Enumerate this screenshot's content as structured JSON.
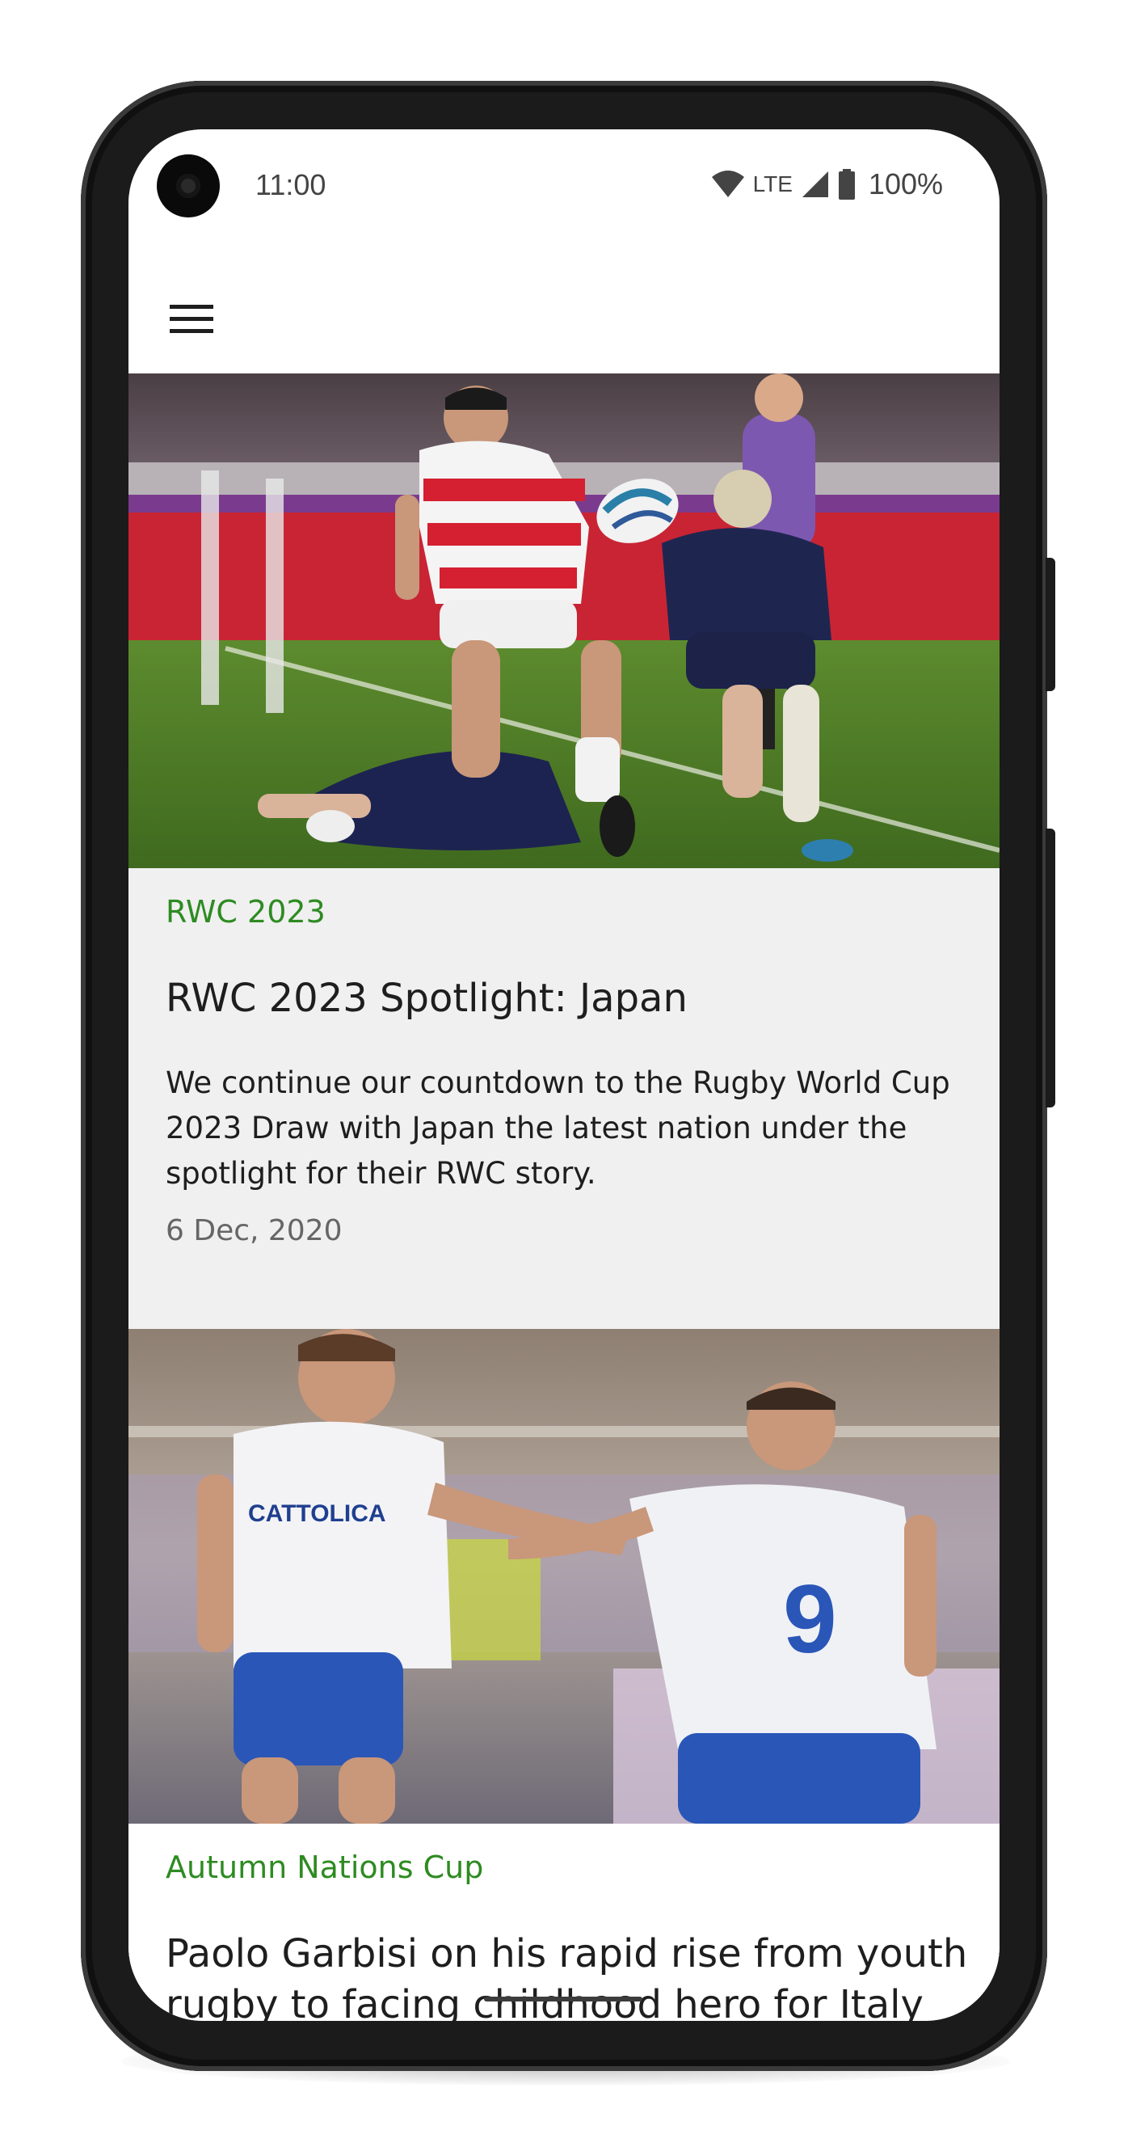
{
  "status_bar": {
    "time": "11:00",
    "network": "LTE",
    "battery": "100%",
    "icons": [
      "wifi-icon",
      "signal-icon",
      "battery-icon"
    ]
  },
  "toolbar": {
    "menu_icon": "hamburger-menu-icon"
  },
  "articles": [
    {
      "category": "RWC 2023",
      "title": "RWC 2023 Spotlight: Japan",
      "summary": "We continue our countdown to the Rugby World Cup 2023 Draw with Japan the latest nation under the spotlight for their RWC story.",
      "date": "6 Dec, 2020"
    },
    {
      "category": "Autumn Nations Cup",
      "title": "Paolo Garbisi on his rapid rise from youth rugby to facing childhood hero for Italy"
    }
  ],
  "colors": {
    "category": "#2e8b22",
    "card_1_background": "#f0f0f0",
    "card_2_background": "#ffffff",
    "text": "#1e1e1e",
    "date": "#666666"
  }
}
